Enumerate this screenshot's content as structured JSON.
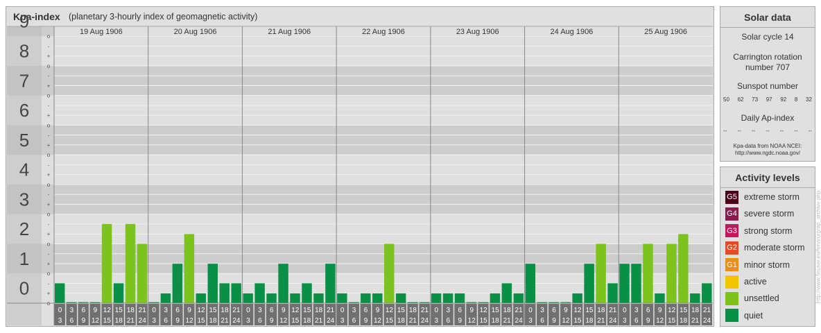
{
  "header": {
    "title": "Kpa-index",
    "subtitle": "(planetary 3-hourly index of geomagnetic activity)"
  },
  "solar": {
    "title": "Solar data",
    "solar_cycle": "Solar cycle 14",
    "carrington_line1": "Carrington rotation",
    "carrington_line2": "number 707",
    "sunspot_label": "Sunspot number",
    "sunspot_values": [
      "50",
      "62",
      "73",
      "97",
      "92",
      "8",
      "32"
    ],
    "ap_label": "Daily Ap-index",
    "ap_values": [
      "--",
      "--",
      "--",
      "--",
      "--",
      "--",
      "--"
    ],
    "source_line1": "Kpa-data from NOAA NCEI:",
    "source_line2": "http://www.ngdc.noaa.gov/"
  },
  "activity": {
    "title": "Activity levels",
    "levels": [
      {
        "code": "G5",
        "label": "extreme storm",
        "color": "#4d0019"
      },
      {
        "code": "G4",
        "label": "severe storm",
        "color": "#8b1a4f"
      },
      {
        "code": "G3",
        "label": "strong storm",
        "color": "#c2185b"
      },
      {
        "code": "G2",
        "label": "moderate storm",
        "color": "#e04e1f"
      },
      {
        "code": "G1",
        "label": "minor storm",
        "color": "#f08c1a"
      },
      {
        "code": "",
        "label": "active",
        "color": "#f5c400"
      },
      {
        "code": "",
        "label": "unsettled",
        "color": "#7dc31e"
      },
      {
        "code": "",
        "label": "quiet",
        "color": "#0a8f46"
      }
    ]
  },
  "credit": "http://www.fleuser.eu/fenaturgrap_archive.php",
  "chart_data": {
    "type": "bar",
    "y_ticks": [
      "0",
      "1",
      "2",
      "3",
      "4",
      "5",
      "6",
      "7",
      "8",
      "9"
    ],
    "minor_labels": [
      "o",
      "+",
      "-"
    ],
    "ylim": [
      0,
      9.33
    ],
    "days": [
      "19 Aug 1906",
      "20 Aug 1906",
      "21 Aug 1906",
      "22 Aug 1906",
      "23 Aug 1906",
      "24 Aug 1906",
      "25 Aug 1906"
    ],
    "interval_start": [
      "0",
      "3",
      "6",
      "9",
      "12",
      "15",
      "18",
      "21"
    ],
    "interval_end": [
      "3",
      "6",
      "9",
      "12",
      "15",
      "18",
      "21",
      "24"
    ],
    "colors": {
      "quiet": "#0a8f46",
      "unsettled": "#7dc31e"
    },
    "values": [
      [
        0.67,
        0.0,
        0.0,
        0.0,
        2.67,
        0.67,
        2.67,
        2.0
      ],
      [
        0.0,
        0.33,
        1.33,
        2.33,
        0.33,
        1.33,
        0.67,
        0.67
      ],
      [
        0.33,
        0.67,
        0.33,
        1.33,
        0.33,
        0.67,
        0.33,
        1.33
      ],
      [
        0.33,
        0.0,
        0.33,
        0.33,
        2.0,
        0.33,
        0.0,
        0.0
      ],
      [
        0.33,
        0.33,
        0.33,
        0.0,
        0.0,
        0.33,
        0.67,
        0.33
      ],
      [
        1.33,
        0.0,
        0.0,
        0.0,
        0.33,
        1.33,
        2.0,
        0.67
      ],
      [
        1.33,
        1.33,
        2.0,
        0.33,
        2.0,
        2.33,
        0.33,
        0.67
      ]
    ]
  }
}
